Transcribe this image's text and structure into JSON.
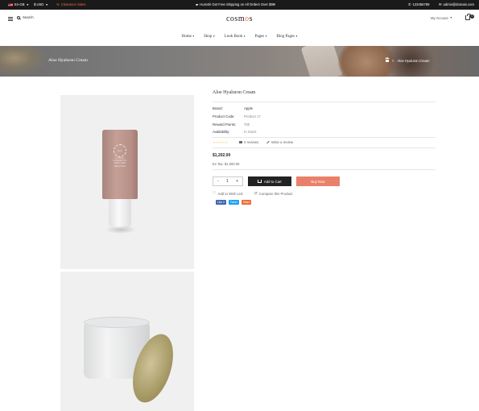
{
  "topbar": {
    "language": "En-GB",
    "currency": "$ USD",
    "clearance": "Clearance Sales",
    "promo": "Hurrah! Get Free Shipping on All Orders Over $99!",
    "phone": "123456789",
    "email": "admin@domain.com"
  },
  "header": {
    "search_label": "Search",
    "logo_text": "cosm",
    "logo_accent": "o",
    "logo_end": "s",
    "account_label": "My Account",
    "cart_count": "0"
  },
  "nav": {
    "items": [
      {
        "label": "Home"
      },
      {
        "label": "Shop"
      },
      {
        "label": "Look Book"
      },
      {
        "label": "Pages"
      },
      {
        "label": "Blog Pages"
      }
    ]
  },
  "banner": {
    "title": "Aloe Hyaluron Cream",
    "breadcrumb_current": "Aloe Hyaluron Cream",
    "separator": ">"
  },
  "product": {
    "title": "Aloe Hyaluron Cream",
    "image_text": "FLORAL COSMETICS SKINCARE MOCKUPS",
    "image_badge": "No.5",
    "specs": [
      {
        "key": "Brand:",
        "value": "Apple"
      },
      {
        "key": "Product Code:",
        "value": "Product 17"
      },
      {
        "key": "Reward Points:",
        "value": "700"
      },
      {
        "key": "Availability:",
        "value": "In Stock"
      }
    ],
    "rating_stars": "☆☆☆☆☆",
    "rating_value": 0,
    "reviews": "0 reviews",
    "write_review": "Write a review",
    "price": "$1,202.00",
    "ex_tax": "Ex Tax: $1,000.00",
    "qty_minus": "-",
    "qty_value": "1",
    "qty_plus": "+",
    "add_to_cart": "Add to Cart",
    "buy_now": "Buy Now",
    "wishlist": "Add to Wish List",
    "compare": "Compare this Product",
    "share": {
      "facebook": "Like 0",
      "twitter": "Tweet",
      "other": "Share"
    }
  },
  "colors": {
    "accent": "#f06a3a",
    "buy_now": "#e9816a",
    "dark": "#222222"
  }
}
